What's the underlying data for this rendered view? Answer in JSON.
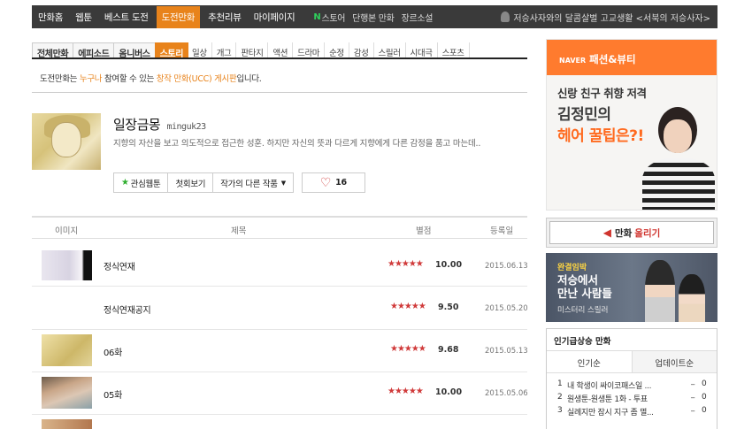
{
  "topnav": {
    "items": [
      "만화홈",
      "웹툰",
      "베스트 도전",
      "도전만화",
      "추천리뷰",
      "마이페이지"
    ],
    "active_index": 3,
    "extras": [
      "스토어",
      "단행본 만화",
      "장르소설"
    ],
    "store_icon_letter": "N",
    "promo": "저승사자와의 달콤살벌 고교생활 <서북의 저승사자>"
  },
  "categories": {
    "bold": [
      "전체만화",
      "에피소드",
      "옴니버스",
      "스토리"
    ],
    "active": "스토리",
    "genres": [
      "일상",
      "개그",
      "판타지",
      "액션",
      "드라마",
      "순정",
      "감성",
      "스릴러",
      "시대극",
      "스포츠"
    ]
  },
  "notice": {
    "prefix": "도전만화는 ",
    "highlight1": "누구나",
    "middle": " 참여할 수 있는 ",
    "highlight2": "창작 만화(UCC) 게시판",
    "suffix": "입니다."
  },
  "comic": {
    "title": "일장금몽",
    "author": "minguk23",
    "description": "지향의 자산을 보고 의도적으로 접근한 성훈. 하지만 자신의 뜻과 다르게 지향에게 다른 감정을 품고 마는데..",
    "buttons": {
      "favorite": "관심웹툰",
      "first": "첫회보기",
      "other_works": "작가의 다른 작품",
      "likes": "16"
    }
  },
  "table": {
    "headers": {
      "image": "이미지",
      "title": "제목",
      "rating": "별점",
      "date": "등록일"
    },
    "rows": [
      {
        "title": "정식연재",
        "stars": "★★★★★",
        "score": "10.00",
        "date": "2015.06.13"
      },
      {
        "title": "정식연재공지",
        "stars": "★★★★★",
        "score": "9.50",
        "date": "2015.05.20"
      },
      {
        "title": "06화",
        "stars": "★★★★★",
        "score": "9.68",
        "date": "2015.05.13"
      },
      {
        "title": "05화",
        "stars": "★★★★★",
        "score": "10.00",
        "date": "2015.05.06"
      }
    ]
  },
  "ad_top": {
    "brand": "NAVER",
    "band": "패션&뷰티",
    "line1": "신랑 친구 취향 저격",
    "line2": "김정민의",
    "line3": "헤어 꿀팁은?!"
  },
  "upload": {
    "prefix": "만화",
    "highlight": "올리기"
  },
  "ad_mid": {
    "tag": "완결임박",
    "title1": "저승에서",
    "title2": "만난 사람들",
    "sub": "미스터리 스릴러"
  },
  "ranking": {
    "title": "인기급상승 만화",
    "tabs": [
      "인기순",
      "업데이트순"
    ],
    "items": [
      {
        "n": "1",
        "title": "내 학생이 싸이코패스일 ...",
        "v": "0"
      },
      {
        "n": "2",
        "title": "원생툰-원생툰 1화 - 투표",
        "v": "0"
      },
      {
        "n": "3",
        "title": "실례지만 잠시 지구 좀 멸...",
        "v": "0"
      }
    ]
  }
}
